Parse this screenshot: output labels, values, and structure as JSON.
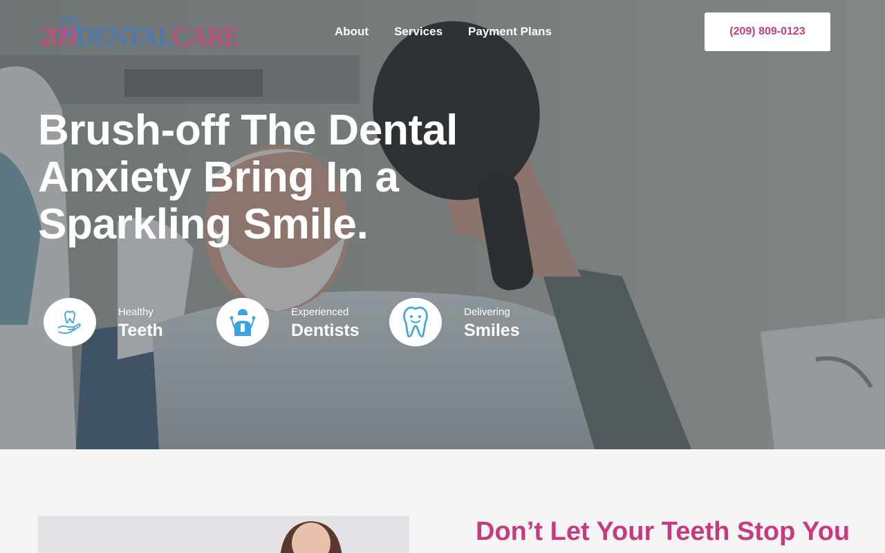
{
  "brand": {
    "logo_number": "209",
    "logo_word1": "DENTAL",
    "logo_word2": "CARE"
  },
  "nav": {
    "items": [
      "About",
      "Services",
      "Payment Plans"
    ]
  },
  "header": {
    "phone": "(209) 809-0123"
  },
  "hero": {
    "headline_line1": "Brush-off The Dental",
    "headline_line2": "Anxiety Bring In a",
    "headline_line3": "Sparkling Smile.",
    "features": [
      {
        "small": "Healthy",
        "big": "Teeth",
        "icon": "tooth-hand-icon"
      },
      {
        "small": "Experienced",
        "big": "Dentists",
        "icon": "dentist-icon"
      },
      {
        "small": "Delivering",
        "big": "Smiles",
        "icon": "smiling-tooth-icon"
      }
    ]
  },
  "section": {
    "title": "Don’t Let Your Teeth Stop You"
  },
  "colors": {
    "brand_pink": "#c73a80",
    "brand_blue": "#3f7cc4",
    "icon_blue": "#3aa3e3"
  }
}
